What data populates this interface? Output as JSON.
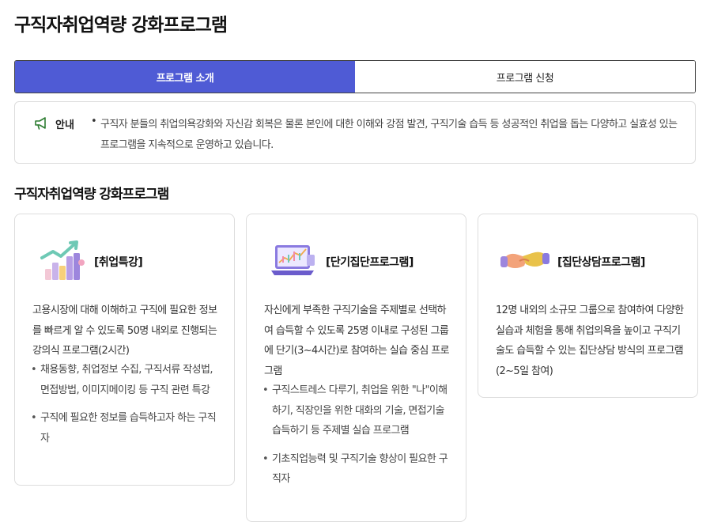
{
  "page": {
    "title": "구직자취업역량 강화프로그램"
  },
  "tabs": [
    {
      "label": "프로그램 소개",
      "active": true
    },
    {
      "label": "프로그램 신청",
      "active": false
    }
  ],
  "notice": {
    "label": "안내",
    "icon": "megaphone-icon",
    "text": "구직자 분들의 취업의욕강화와 자신감 회복은 물론 본인에 대한 이해와 강점 발견, 구직기술 습득 등 성공적인 취업을 돕는 다양하고 실효성 있는 프로그램을 지속적으로 운영하고 있습니다."
  },
  "section": {
    "title": "구직자취업역량 강화프로그램"
  },
  "colors": {
    "accent": "#4f5bd5",
    "border": "#dddddd",
    "notice_icon": "#2e7d32"
  },
  "cards": [
    {
      "title": "[취업특강]",
      "icon": "growth-chart-icon",
      "desc": "고용시장에 대해 이해하고 구직에 필요한 정보를 빠르게 알 수 있도록 50명 내외로 진행되는 강의식 프로그램(2시간)",
      "bullets": [
        "채용동향, 취업정보 수집, 구직서류 작성법, 면접방법, 이미지메이킹 등 구직 관련 특강",
        "구직에 필요한 정보를 습득하고자 하는 구직자"
      ]
    },
    {
      "title": "[단기집단프로그램]",
      "icon": "laptop-chart-icon",
      "desc": "자신에게 부족한 구직기술을 주제별로 선택하여 습득할 수 있도록 25명 이내로 구성된 그룹에 단기(3~4시간)로 참여하는 실습 중심 프로그램",
      "bullets": [
        "구직스트레스 다루기, 취업을 위한 \"나\"이해하기, 직장인을 위한 대화의 기술, 면접기술 습득하기 등 주제별 실습 프로그램",
        "기초직업능력 및 구직기술 향상이 필요한 구직자"
      ]
    },
    {
      "title": "[집단상담프로그램]",
      "icon": "handshake-icon",
      "desc": "12명 내외의 소규모 그룹으로 참여하여 다양한 실습과 체험을 통해 취업의욕을 높이고 구직기술도 습득할 수 있는 집단상담 방식의 프로그램 (2~5일 참여)",
      "bullets": []
    }
  ]
}
